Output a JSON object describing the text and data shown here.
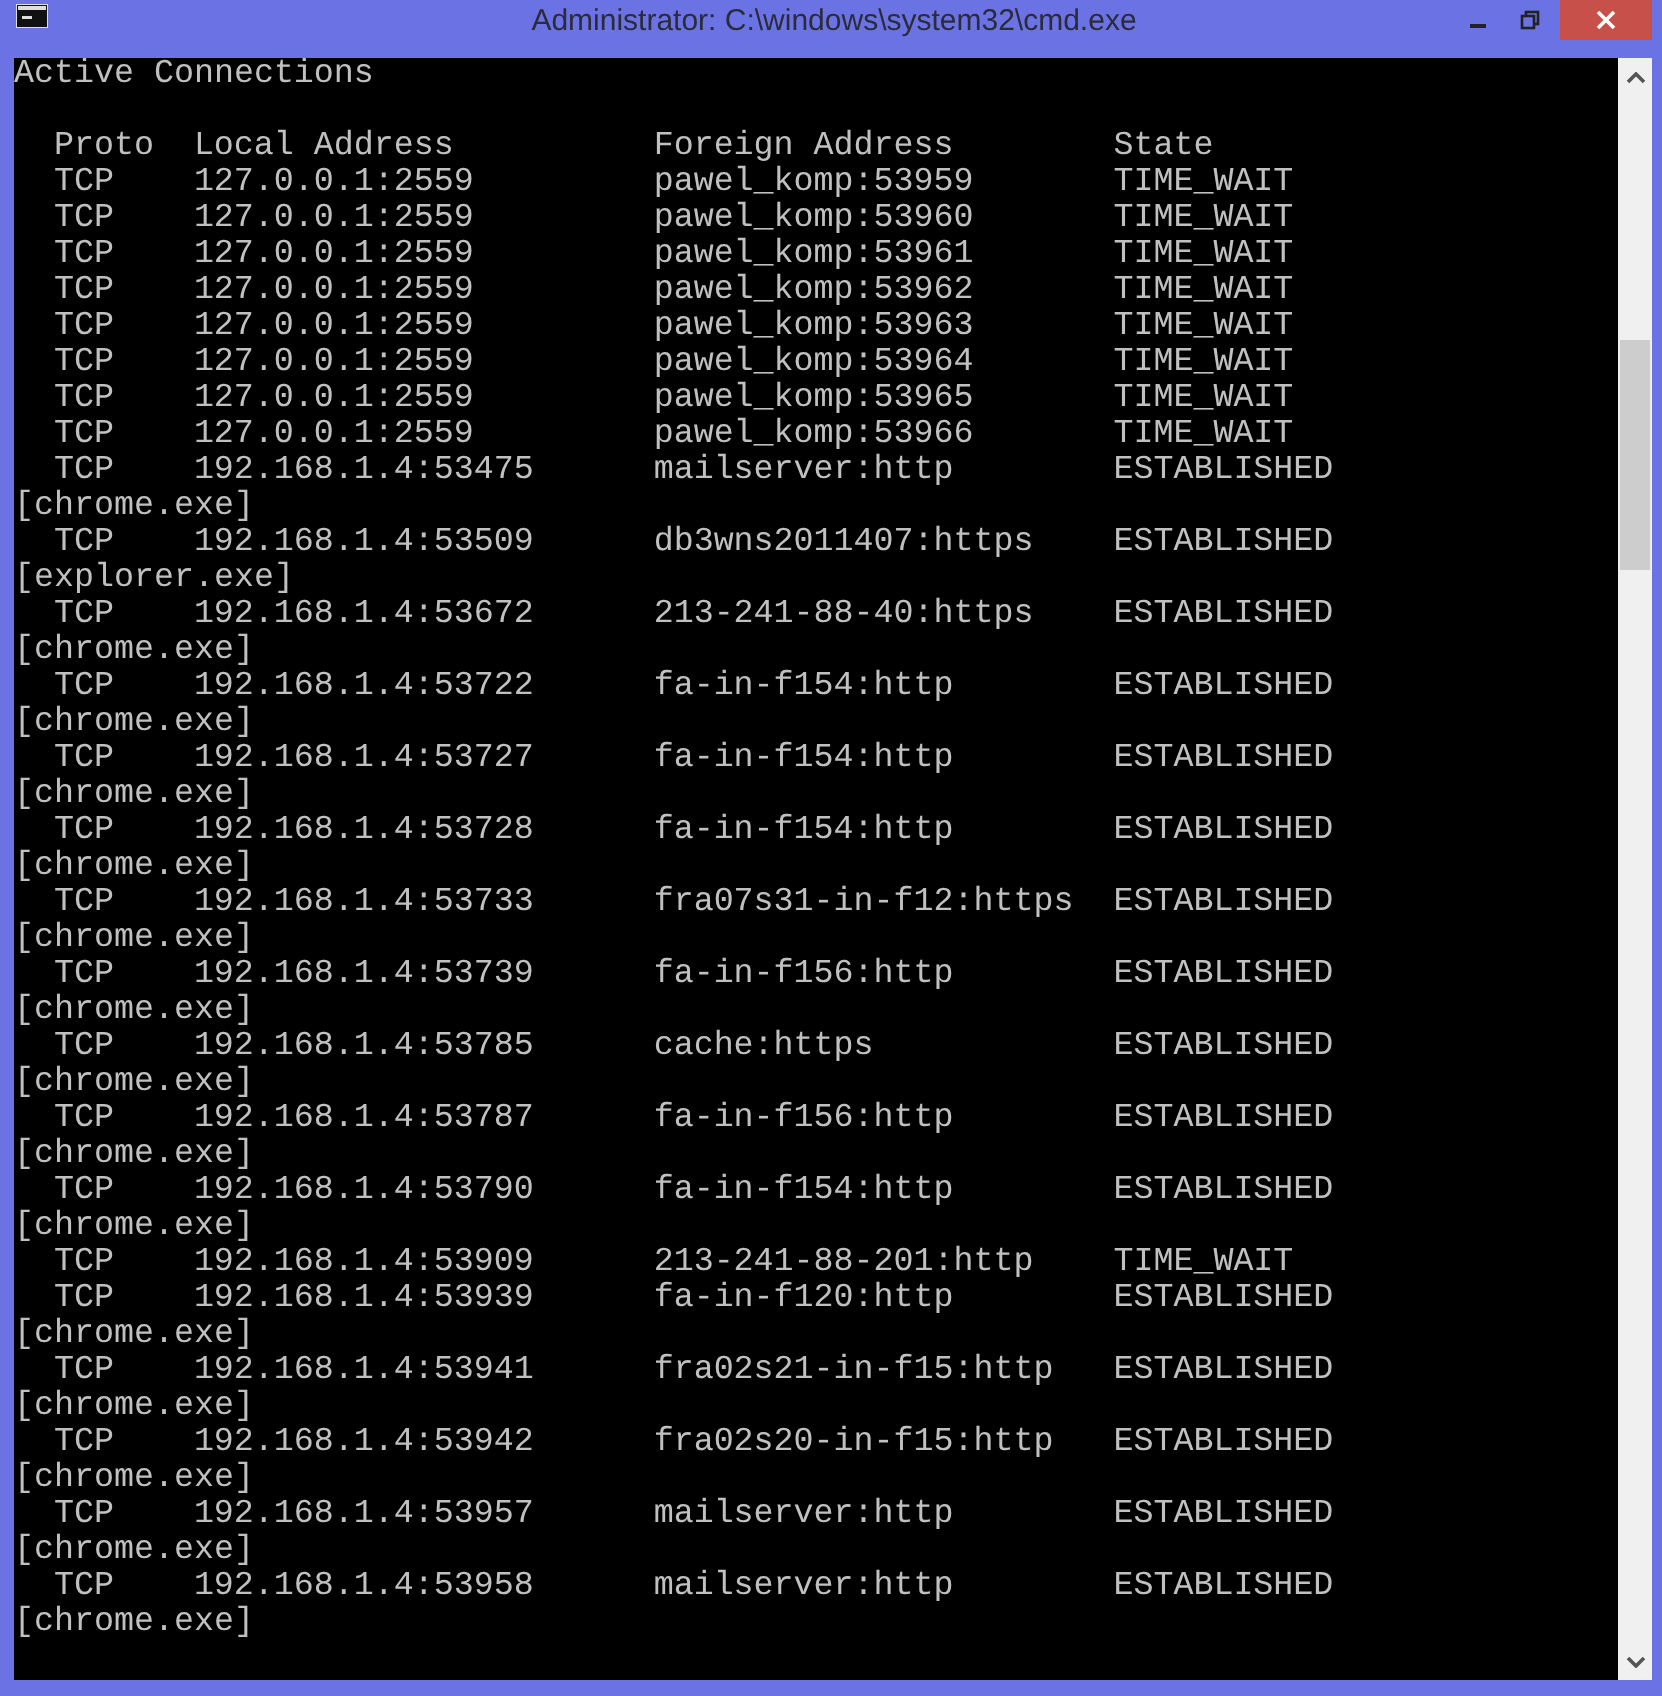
{
  "window": {
    "title": "Administrator: C:\\windows\\system32\\cmd.exe"
  },
  "heading": "Active Connections",
  "columns": [
    "Proto",
    "Local Address",
    "Foreign Address",
    "State"
  ],
  "rows": [
    {
      "proto": "TCP",
      "local": "127.0.0.1:2559",
      "foreign": "pawel_komp:53959",
      "state": "TIME_WAIT"
    },
    {
      "proto": "TCP",
      "local": "127.0.0.1:2559",
      "foreign": "pawel_komp:53960",
      "state": "TIME_WAIT"
    },
    {
      "proto": "TCP",
      "local": "127.0.0.1:2559",
      "foreign": "pawel_komp:53961",
      "state": "TIME_WAIT"
    },
    {
      "proto": "TCP",
      "local": "127.0.0.1:2559",
      "foreign": "pawel_komp:53962",
      "state": "TIME_WAIT"
    },
    {
      "proto": "TCP",
      "local": "127.0.0.1:2559",
      "foreign": "pawel_komp:53963",
      "state": "TIME_WAIT"
    },
    {
      "proto": "TCP",
      "local": "127.0.0.1:2559",
      "foreign": "pawel_komp:53964",
      "state": "TIME_WAIT"
    },
    {
      "proto": "TCP",
      "local": "127.0.0.1:2559",
      "foreign": "pawel_komp:53965",
      "state": "TIME_WAIT"
    },
    {
      "proto": "TCP",
      "local": "127.0.0.1:2559",
      "foreign": "pawel_komp:53966",
      "state": "TIME_WAIT"
    },
    {
      "proto": "TCP",
      "local": "192.168.1.4:53475",
      "foreign": "mailserver:http",
      "state": "ESTABLISHED",
      "process": "[chrome.exe]"
    },
    {
      "proto": "TCP",
      "local": "192.168.1.4:53509",
      "foreign": "db3wns2011407:https",
      "state": "ESTABLISHED",
      "process": "[explorer.exe]"
    },
    {
      "proto": "TCP",
      "local": "192.168.1.4:53672",
      "foreign": "213-241-88-40:https",
      "state": "ESTABLISHED",
      "process": "[chrome.exe]"
    },
    {
      "proto": "TCP",
      "local": "192.168.1.4:53722",
      "foreign": "fa-in-f154:http",
      "state": "ESTABLISHED",
      "process": "[chrome.exe]"
    },
    {
      "proto": "TCP",
      "local": "192.168.1.4:53727",
      "foreign": "fa-in-f154:http",
      "state": "ESTABLISHED",
      "process": "[chrome.exe]"
    },
    {
      "proto": "TCP",
      "local": "192.168.1.4:53728",
      "foreign": "fa-in-f154:http",
      "state": "ESTABLISHED",
      "process": "[chrome.exe]"
    },
    {
      "proto": "TCP",
      "local": "192.168.1.4:53733",
      "foreign": "fra07s31-in-f12:https",
      "state": "ESTABLISHED",
      "process": "[chrome.exe]"
    },
    {
      "proto": "TCP",
      "local": "192.168.1.4:53739",
      "foreign": "fa-in-f156:http",
      "state": "ESTABLISHED",
      "process": "[chrome.exe]"
    },
    {
      "proto": "TCP",
      "local": "192.168.1.4:53785",
      "foreign": "cache:https",
      "state": "ESTABLISHED",
      "process": "[chrome.exe]"
    },
    {
      "proto": "TCP",
      "local": "192.168.1.4:53787",
      "foreign": "fa-in-f156:http",
      "state": "ESTABLISHED",
      "process": "[chrome.exe]"
    },
    {
      "proto": "TCP",
      "local": "192.168.1.4:53790",
      "foreign": "fa-in-f154:http",
      "state": "ESTABLISHED",
      "process": "[chrome.exe]"
    },
    {
      "proto": "TCP",
      "local": "192.168.1.4:53909",
      "foreign": "213-241-88-201:http",
      "state": "TIME_WAIT"
    },
    {
      "proto": "TCP",
      "local": "192.168.1.4:53939",
      "foreign": "fa-in-f120:http",
      "state": "ESTABLISHED",
      "process": "[chrome.exe]"
    },
    {
      "proto": "TCP",
      "local": "192.168.1.4:53941",
      "foreign": "fra02s21-in-f15:http",
      "state": "ESTABLISHED",
      "process": "[chrome.exe]"
    },
    {
      "proto": "TCP",
      "local": "192.168.1.4:53942",
      "foreign": "fra02s20-in-f15:http",
      "state": "ESTABLISHED",
      "process": "[chrome.exe]"
    },
    {
      "proto": "TCP",
      "local": "192.168.1.4:53957",
      "foreign": "mailserver:http",
      "state": "ESTABLISHED",
      "process": "[chrome.exe]"
    },
    {
      "proto": "TCP",
      "local": "192.168.1.4:53958",
      "foreign": "mailserver:http",
      "state": "ESTABLISHED",
      "process": "[chrome.exe]"
    }
  ]
}
